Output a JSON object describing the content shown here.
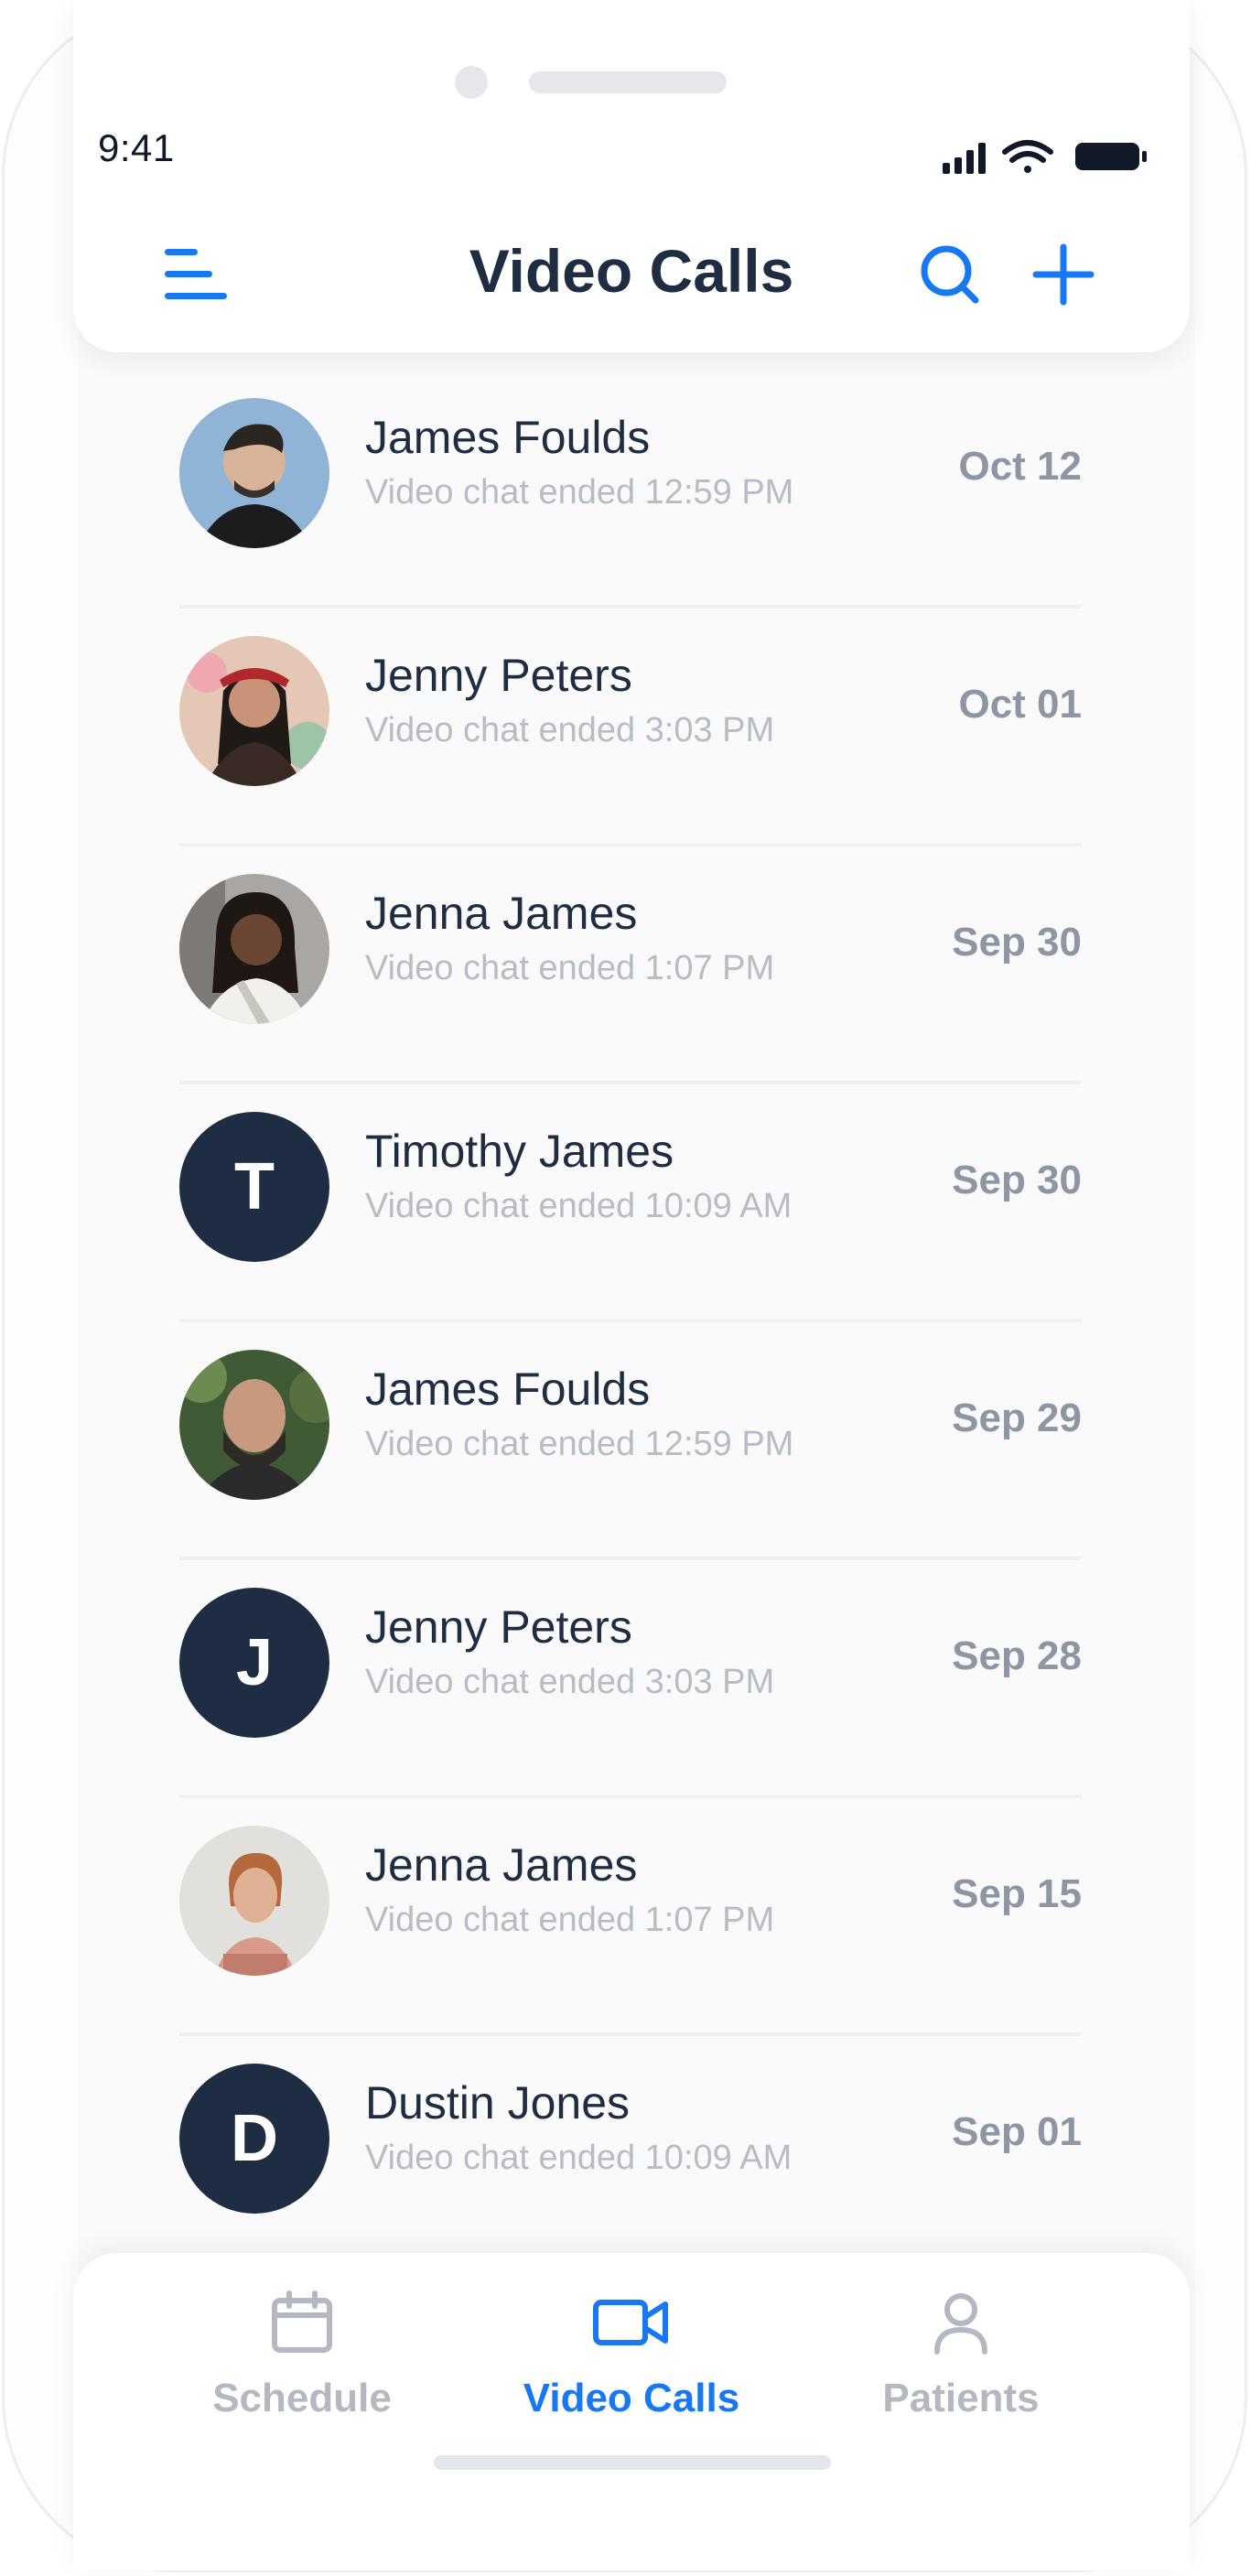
{
  "status_bar": {
    "time": "9:41"
  },
  "header": {
    "title": "Video Calls"
  },
  "calls": [
    {
      "name": "James Foulds",
      "subtitle": "Video chat ended 12:59 PM",
      "date": "Oct 12",
      "avatar": "photo"
    },
    {
      "name": "Jenny Peters",
      "subtitle": "Video chat ended 3:03 PM",
      "date": "Oct 01",
      "avatar": "photo"
    },
    {
      "name": "Jenna James",
      "subtitle": "Video chat ended 1:07 PM",
      "date": "Sep 30",
      "avatar": "photo"
    },
    {
      "name": "Timothy James",
      "subtitle": "Video chat ended 10:09 AM",
      "date": "Sep 30",
      "avatar": "initial",
      "initial": "T"
    },
    {
      "name": "James Foulds",
      "subtitle": "Video chat ended 12:59 PM",
      "date": "Sep 29",
      "avatar": "photo"
    },
    {
      "name": "Jenny Peters",
      "subtitle": "Video chat ended 3:03 PM",
      "date": "Sep 28",
      "avatar": "initial",
      "initial": "J"
    },
    {
      "name": "Jenna James",
      "subtitle": "Video chat ended 1:07 PM",
      "date": "Sep 15",
      "avatar": "photo"
    },
    {
      "name": "Dustin Jones",
      "subtitle": "Video chat ended 10:09 AM",
      "date": "Sep 01",
      "avatar": "initial",
      "initial": "D"
    }
  ],
  "tabs": [
    {
      "label": "Schedule",
      "icon": "calendar-icon",
      "active": false
    },
    {
      "label": "Video Calls",
      "icon": "video-camera-icon",
      "active": true
    },
    {
      "label": "Patients",
      "icon": "person-icon",
      "active": false
    }
  ],
  "colors": {
    "accent": "#1778f2",
    "text_dark": "#1f2d43",
    "text_muted": "#b7bcc5",
    "date": "#8e96a3",
    "tab_inactive": "#b4b9c1"
  }
}
